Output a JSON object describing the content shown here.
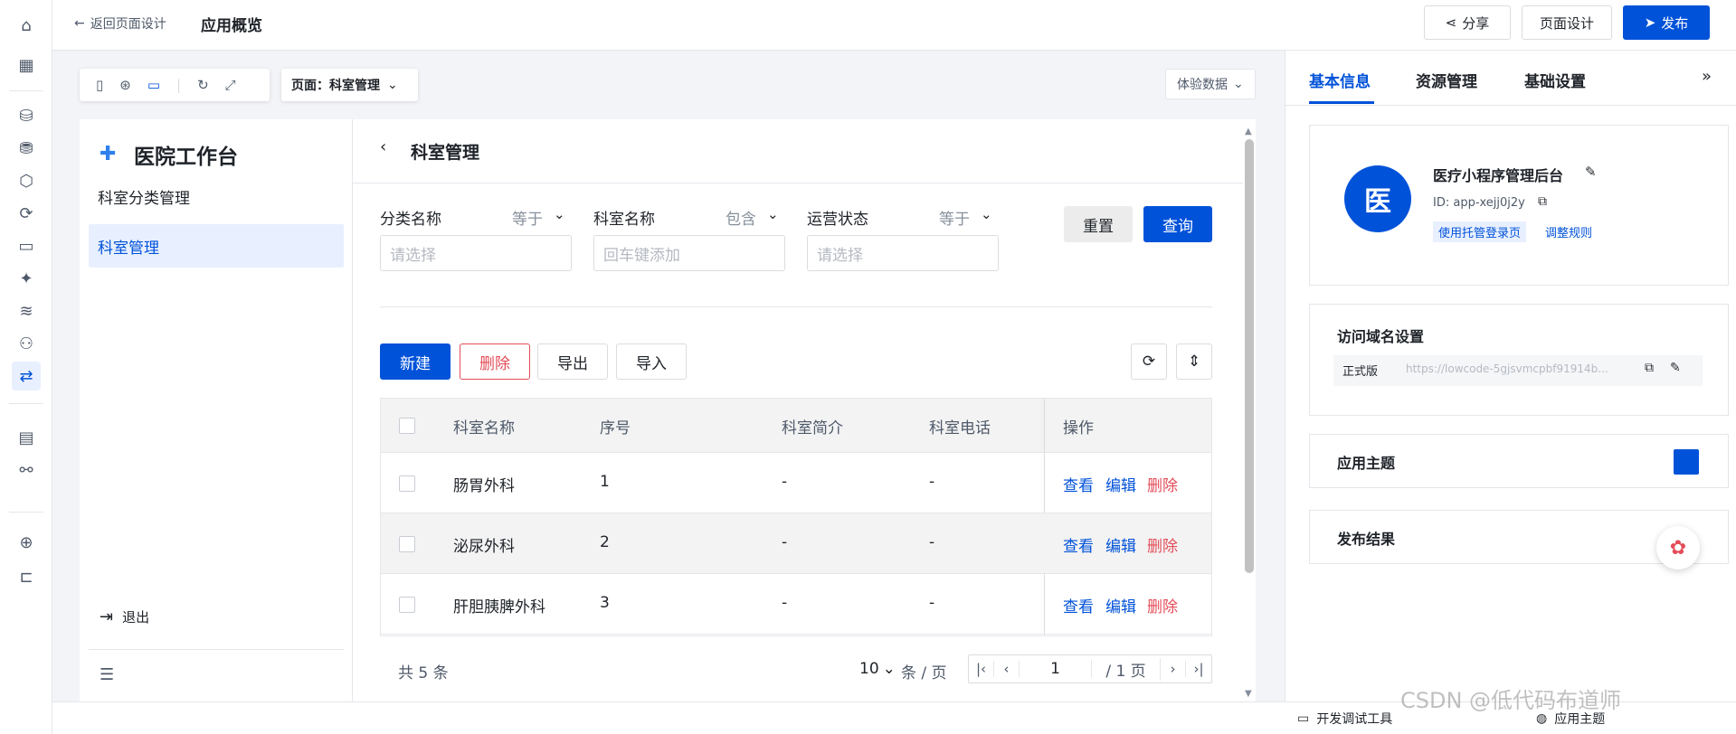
{
  "topbar": {
    "back_label": "返回页面设计",
    "title": "应用概览",
    "share_label": "分享",
    "design_label": "页面设计",
    "publish_label": "发布"
  },
  "canvas_toolbar": {
    "page_label": "页面：科室管理",
    "data_label": "体验数据"
  },
  "app": {
    "name": "医院工作台",
    "nav": [
      {
        "label": "科室分类管理"
      },
      {
        "label": "科室管理"
      }
    ],
    "logout_label": "退出"
  },
  "main": {
    "page_title": "科室管理",
    "filters": [
      {
        "label": "分类名称",
        "op": "等于",
        "placeholder": "请选择"
      },
      {
        "label": "科室名称",
        "op": "包含",
        "placeholder": "回车键添加"
      },
      {
        "label": "运营状态",
        "op": "等于",
        "placeholder": "请选择"
      }
    ],
    "reset_label": "重置",
    "query_label": "查询",
    "new_label": "新建",
    "delete_label": "删除",
    "export_label": "导出",
    "import_label": "导入",
    "columns": [
      "科室名称",
      "序号",
      "科室简介",
      "科室电话",
      "操作"
    ],
    "rows": [
      {
        "name": "肠胃外科",
        "index": "1",
        "intro": "-",
        "phone": "-"
      },
      {
        "name": "泌尿外科",
        "index": "2",
        "intro": "-",
        "phone": "-"
      },
      {
        "name": "肝胆胰脾外科",
        "index": "3",
        "intro": "-",
        "phone": "-"
      }
    ],
    "row_actions": {
      "view": "查看",
      "edit": "编辑",
      "delete": "删除"
    },
    "pagination": {
      "total": "共 5 条",
      "page_size": "10",
      "per_page_unit": "条 / 页",
      "current_page": "1",
      "total_pages": "/ 1 页"
    }
  },
  "right_panel": {
    "tabs": [
      "基本信息",
      "资源管理",
      "基础设置"
    ],
    "app_card": {
      "avatar_char": "医",
      "name": "医疗小程序管理后台",
      "id": "ID: app-xejj0j2y",
      "tag": "使用托管登录页",
      "link": "调整规则"
    },
    "domain": {
      "title": "访问域名设置",
      "env": "正式版",
      "url": "https://lowcode-5gjsvmcpbf91914b..."
    },
    "theme_title": "应用主题",
    "theme_color": "#0052d9",
    "publish_result_title": "发布结果"
  },
  "bottombar": {
    "devtools_label": "开发调试工具",
    "theme_label": "应用主题",
    "watermark": "CSDN @低代码布道师"
  }
}
